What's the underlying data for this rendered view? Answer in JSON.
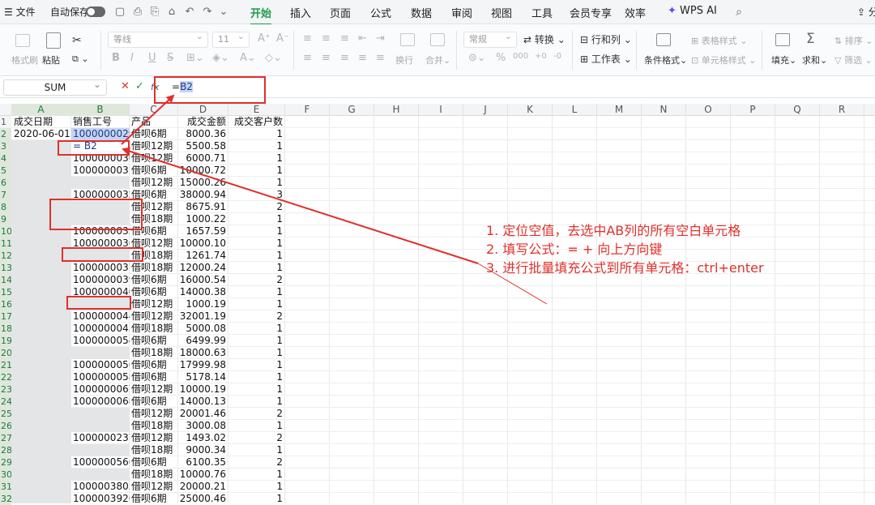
{
  "menubar": {
    "app_menu": "文件",
    "autosave": "自动保存",
    "tabs": [
      "开始",
      "插入",
      "页面",
      "公式",
      "数据",
      "审阅",
      "视图",
      "工具",
      "会员专享",
      "效率"
    ],
    "wps_ai": "WPS AI",
    "share": "分享"
  },
  "ribbon": {
    "format_painter": "格式刷",
    "paste": "粘贴",
    "font_name": "等线",
    "font_size": "11",
    "wrap": "换行",
    "merge": "合并",
    "number_format": "常规",
    "convert": "转换",
    "rows_cols": "行和列",
    "worksheet": "工作表",
    "cond_format": "条件格式",
    "table_style": "表格样式",
    "cell_style": "单元格样式",
    "fill": "填充",
    "sum": "求和",
    "sort": "排序",
    "filter": "筛选"
  },
  "formula_bar": {
    "name_box": "SUM",
    "fx": "fx",
    "prefix": "=",
    "ref": "B2"
  },
  "grid": {
    "columns": [
      "A",
      "B",
      "C",
      "D",
      "E",
      "F",
      "G",
      "H",
      "I",
      "J",
      "K",
      "L",
      "M",
      "N",
      "O",
      "P",
      "Q",
      "R"
    ],
    "headers": [
      "成交日期",
      "销售工号",
      "产品",
      "成交金额",
      "成交客户数"
    ],
    "rows": [
      [
        "2020-06-01",
        "1000000029",
        "借呗6期",
        "8000.36",
        "1"
      ],
      [
        "",
        "= B2",
        "借呗12期",
        "5500.58",
        "1"
      ],
      [
        "",
        "1000000030",
        "借呗12期",
        "6000.71",
        "1"
      ],
      [
        "",
        "1000000031",
        "借呗6期",
        "10000.72",
        "1"
      ],
      [
        "",
        "",
        "借呗12期",
        "15000.26",
        "1"
      ],
      [
        "",
        "1000000032",
        "借呗6期",
        "38000.94",
        "3"
      ],
      [
        "",
        "",
        "借呗12期",
        "8675.91",
        "2"
      ],
      [
        "",
        "",
        "借呗18期",
        "1000.22",
        "1"
      ],
      [
        "",
        "1000000035",
        "借呗6期",
        "1657.59",
        "1"
      ],
      [
        "",
        "1000000036",
        "借呗12期",
        "10000.10",
        "1"
      ],
      [
        "",
        "",
        "借呗18期",
        "1261.74",
        "1"
      ],
      [
        "",
        "1000000037",
        "借呗18期",
        "12000.24",
        "1"
      ],
      [
        "",
        "1000000039",
        "借呗6期",
        "16000.54",
        "2"
      ],
      [
        "",
        "1000000040",
        "借呗6期",
        "14000.38",
        "1"
      ],
      [
        "",
        "",
        "借呗12期",
        "1000.19",
        "1"
      ],
      [
        "",
        "1000000044",
        "借呗12期",
        "32001.19",
        "2"
      ],
      [
        "",
        "1000000045",
        "借呗18期",
        "5000.08",
        "1"
      ],
      [
        "",
        "1000000054",
        "借呗6期",
        "6499.99",
        "1"
      ],
      [
        "",
        "",
        "借呗18期",
        "18000.63",
        "1"
      ],
      [
        "",
        "1000000056",
        "借呗6期",
        "17999.98",
        "1"
      ],
      [
        "",
        "1000000058",
        "借呗6期",
        "5178.14",
        "1"
      ],
      [
        "",
        "1000000067",
        "借呗12期",
        "10000.19",
        "1"
      ],
      [
        "",
        "1000000068",
        "借呗6期",
        "14000.13",
        "1"
      ],
      [
        "",
        "",
        "借呗12期",
        "20001.46",
        "2"
      ],
      [
        "",
        "",
        "借呗18期",
        "3000.08",
        "1"
      ],
      [
        "",
        "1000000237",
        "借呗12期",
        "1493.02",
        "2"
      ],
      [
        "",
        "",
        "借呗18期",
        "9000.34",
        "1"
      ],
      [
        "",
        "1000000566",
        "借呗6期",
        "6100.35",
        "2"
      ],
      [
        "",
        "",
        "借呗18期",
        "10000.76",
        "1"
      ],
      [
        "",
        "1000003803",
        "借呗12期",
        "20000.21",
        "1"
      ],
      [
        "",
        "1000003926",
        "借呗6期",
        "25000.46",
        "1"
      ]
    ]
  },
  "annotation": {
    "lines": [
      "1. 定位空值，去选中AB列的所有空白单元格",
      "2. 填写公式：= + 向上方向键",
      "3. 进行批量填充公式到所有单元格：ctrl+enter"
    ],
    "color": "#e0302b"
  }
}
